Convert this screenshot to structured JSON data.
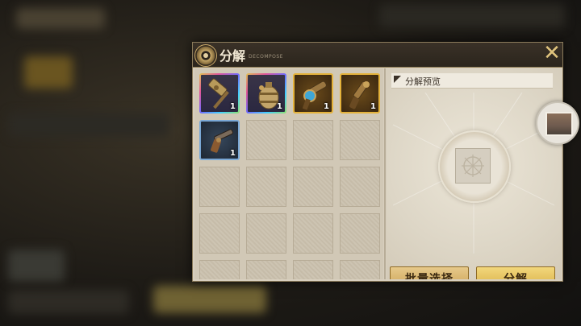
{
  "panel": {
    "title": "分解",
    "subtitle": "DECOMPOSE"
  },
  "inventory": {
    "items": [
      {
        "name": "hammer",
        "rarity": "rainbow",
        "qty": "1"
      },
      {
        "name": "keg",
        "rarity": "rainbow",
        "qty": "1"
      },
      {
        "name": "ray-gun",
        "rarity": "gold",
        "qty": "1"
      },
      {
        "name": "blunderbuss",
        "rarity": "gold",
        "qty": "1"
      },
      {
        "name": "pistol",
        "rarity": "blue",
        "qty": "1"
      }
    ],
    "empty_slots": 15
  },
  "preview": {
    "label": "分解预览"
  },
  "buttons": {
    "batch_select": "批量选择",
    "decompose": "分解"
  },
  "colors": {
    "gold_rarity": "#e4b23b",
    "blue_rarity": "#7aa8d6",
    "button_gold": "#d6ab40"
  }
}
